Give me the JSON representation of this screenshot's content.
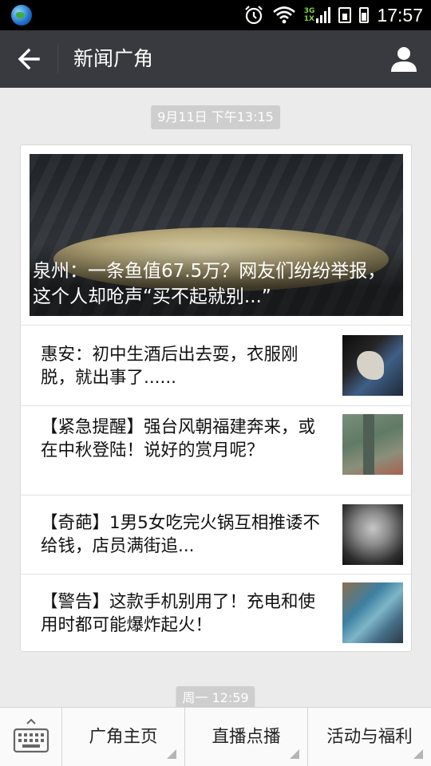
{
  "status_bar": {
    "time": "17:57",
    "network_label_top": "3G",
    "network_label_bottom": "1X"
  },
  "header": {
    "title": "新闻广角",
    "back_icon": "back-arrow-icon",
    "profile_icon": "person-icon"
  },
  "chat": {
    "timestamp_1": "9月11日 下午13:15",
    "timestamp_2": "周一 12:59",
    "article_card": {
      "headline": "泉州：一条鱼值67.5万？网友们纷纷举报，这个人却呛声“买不起就别...”",
      "items": [
        {
          "title": "惠安：初中生酒后出去耍，衣服刚脱，就出事了......"
        },
        {
          "title": "【紧急提醒】强台风朝福建奔来，或在中秋登陆！说好的赏月呢？"
        },
        {
          "title": "【奇葩】1男5女吃完火锅互相推诿不给钱，店员满街追..."
        },
        {
          "title": "【警告】这款手机别用了！充电和使用时都可能爆炸起火！"
        }
      ]
    }
  },
  "bottom_menu": {
    "keyboard_icon": "keyboard-icon",
    "buttons": [
      {
        "label": "广角主页"
      },
      {
        "label": "直播点播"
      },
      {
        "label": "活动与福利"
      }
    ]
  }
}
